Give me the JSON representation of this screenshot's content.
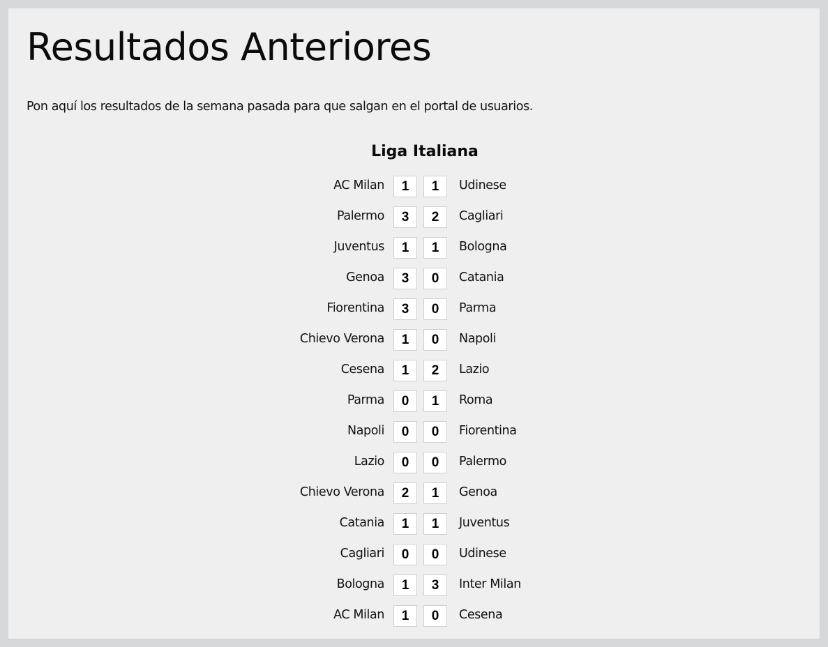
{
  "page": {
    "title": "Resultados Anteriores",
    "intro": "Pon aquí los resultados de la semana pasada para que salgan en el portal de usuarios."
  },
  "league": {
    "title": "Liga Italiana",
    "matches": [
      {
        "home": "AC Milan",
        "home_score": "1",
        "away_score": "1",
        "away": "Udinese"
      },
      {
        "home": "Palermo",
        "home_score": "3",
        "away_score": "2",
        "away": "Cagliari"
      },
      {
        "home": "Juventus",
        "home_score": "1",
        "away_score": "1",
        "away": "Bologna"
      },
      {
        "home": "Genoa",
        "home_score": "3",
        "away_score": "0",
        "away": "Catania"
      },
      {
        "home": "Fiorentina",
        "home_score": "3",
        "away_score": "0",
        "away": "Parma"
      },
      {
        "home": "Chievo Verona",
        "home_score": "1",
        "away_score": "0",
        "away": "Napoli"
      },
      {
        "home": "Cesena",
        "home_score": "1",
        "away_score": "2",
        "away": "Lazio"
      },
      {
        "home": "Parma",
        "home_score": "0",
        "away_score": "1",
        "away": "Roma"
      },
      {
        "home": "Napoli",
        "home_score": "0",
        "away_score": "0",
        "away": "Fiorentina"
      },
      {
        "home": "Lazio",
        "home_score": "0",
        "away_score": "0",
        "away": "Palermo"
      },
      {
        "home": "Chievo Verona",
        "home_score": "2",
        "away_score": "1",
        "away": "Genoa"
      },
      {
        "home": "Catania",
        "home_score": "1",
        "away_score": "1",
        "away": "Juventus"
      },
      {
        "home": "Cagliari",
        "home_score": "0",
        "away_score": "0",
        "away": "Udinese"
      },
      {
        "home": "Bologna",
        "home_score": "1",
        "away_score": "3",
        "away": "Inter Milan"
      },
      {
        "home": "AC Milan",
        "home_score": "1",
        "away_score": "0",
        "away": "Cesena"
      }
    ]
  }
}
